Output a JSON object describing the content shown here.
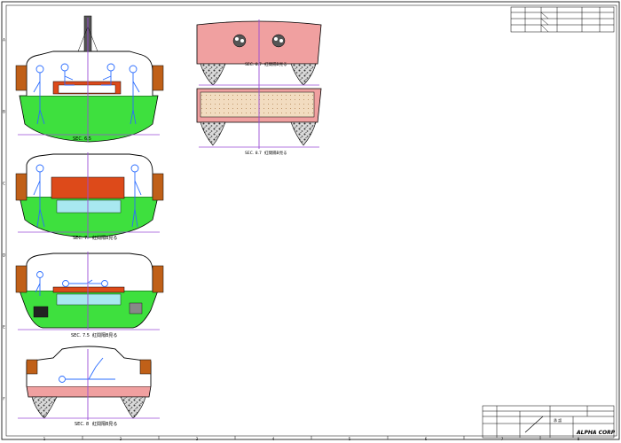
{
  "sections": [
    {
      "id": "sec-6-5",
      "label": "SEC. 6.5",
      "sublabel": ""
    },
    {
      "id": "sec-7",
      "label": "SEC. 7",
      "sublabel": "紅間隔B見る"
    },
    {
      "id": "sec-7-5",
      "label": "SEC. 7.5",
      "sublabel": "紅間隔B見る"
    },
    {
      "id": "sec-8",
      "label": "SEC. 8",
      "sublabel": "紅間隔B見る"
    },
    {
      "id": "sec-8-7-upper",
      "label": "SEC. 8.7",
      "sublabel": "紅間隔B見る"
    },
    {
      "id": "sec-8-7-lower",
      "label": "SEC. 8.7",
      "sublabel": "紅間隔B見る"
    }
  ],
  "border": {
    "top_numbers": [
      "1",
      "2",
      "3",
      "4",
      "5",
      "6",
      "7",
      "8"
    ],
    "side_letters": [
      "A",
      "B",
      "C",
      "D",
      "E",
      "F"
    ]
  },
  "title_block": {
    "company": "ALPHA CORP",
    "small_label": "承 認"
  },
  "colors": {
    "hull_green": "#3ee03e",
    "hull_pink": "#f0a0a0",
    "deck_orange": "#dd4a1a",
    "bulkhead_brown": "#c06018",
    "figure_blue": "#2a6cff",
    "water_cyan": "#a8e8f0",
    "centerline": "#9a4dd6",
    "sand": "#f2dcc0",
    "outline": "#000000"
  }
}
